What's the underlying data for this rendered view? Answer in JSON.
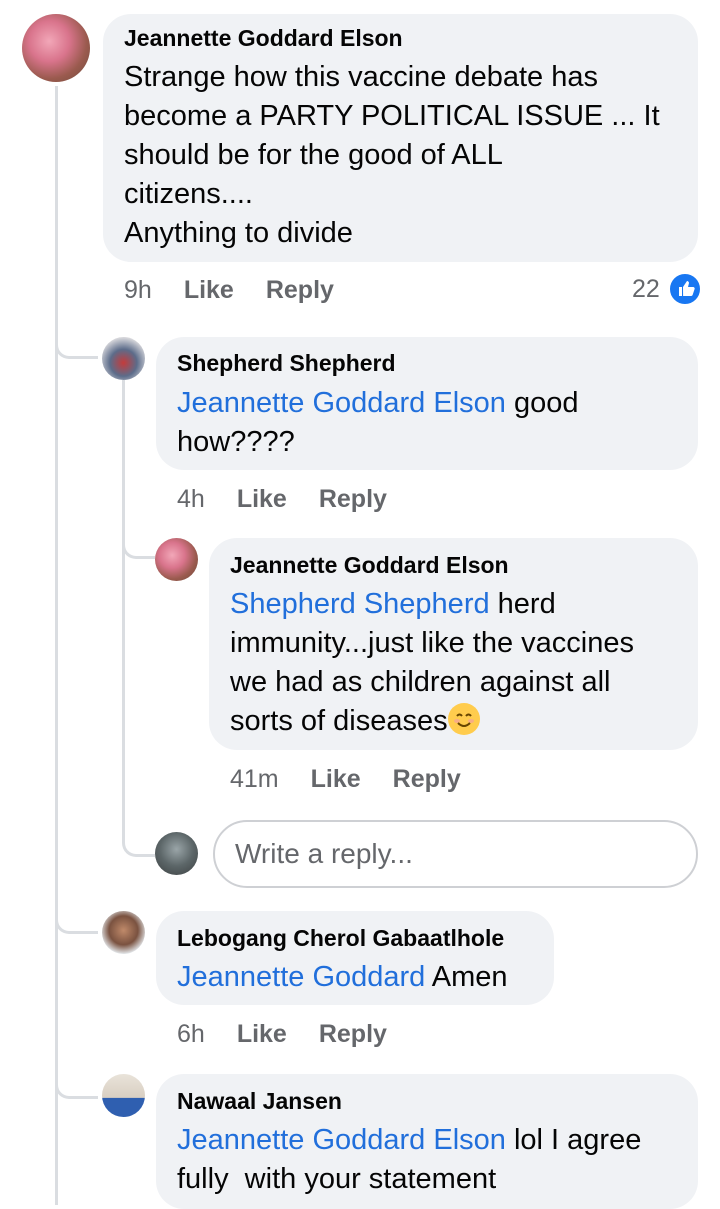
{
  "comments": [
    {
      "author": "Jeannette Goddard Elson",
      "lines": [
        "Strange how this vaccine debate has",
        "become a PARTY POLITICAL ISSUE ... It",
        "should be for the good of ALL",
        "citizens....",
        "Anything to divide"
      ],
      "time": "9h",
      "like_label": "Like",
      "reply_label": "Reply",
      "reaction_count": "22",
      "reaction_icon": "like-reaction-icon"
    },
    {
      "author": "Shepherd Shepherd",
      "mention": "Jeannette Goddard Elson",
      "text_after_mention": " good",
      "line2": "how????",
      "time": "4h",
      "like_label": "Like",
      "reply_label": "Reply"
    },
    {
      "author": "Jeannette Goddard Elson",
      "mention": "Shepherd Shepherd",
      "text_after_mention": " herd",
      "line2": "immunity...just like the vaccines",
      "line3": "we had as children against all",
      "line4": "sorts of diseases",
      "emoji": "smiling-face-emoji",
      "time": "41m",
      "like_label": "Like",
      "reply_label": "Reply"
    },
    {
      "author": "Lebogang Cherol Gabaatlhole",
      "mention": "Jeannette Goddard",
      "text_after_mention": " Amen",
      "time": "6h",
      "like_label": "Like",
      "reply_label": "Reply"
    },
    {
      "author": "Nawaal Jansen",
      "mention": "Jeannette Goddard Elson",
      "text_after_mention": " lol I agree",
      "line2": "fully  with your statement"
    }
  ],
  "reply_box": {
    "placeholder": "Write a reply..."
  },
  "colors": {
    "mention": "#216fdb",
    "bubble": "#f0f2f5",
    "meta": "#65676b",
    "like_badge": "#1877f2"
  }
}
